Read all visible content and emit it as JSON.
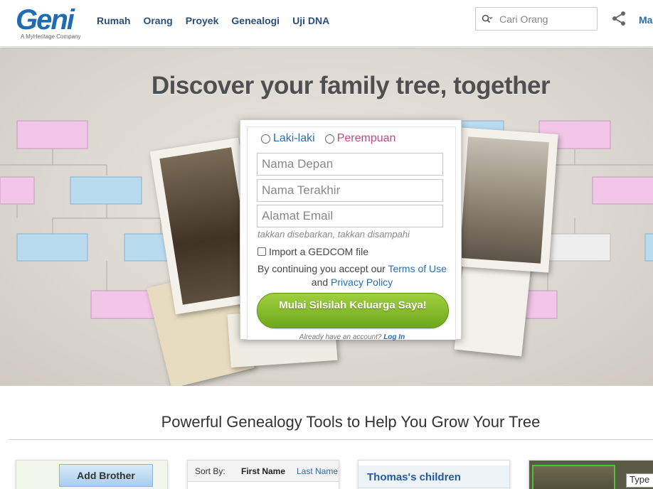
{
  "header": {
    "logo_text": "Geni",
    "logo_tagline": "A MyHeritage Company",
    "nav": [
      "Rumah",
      "Orang",
      "Proyek",
      "Genealogi",
      "Uji DNA"
    ],
    "search_placeholder": "Cari Orang",
    "more_label": "Ma"
  },
  "hero": {
    "title": "Discover your family tree, together"
  },
  "signup": {
    "gender_male": "Laki-laki",
    "gender_female": "Perempuan",
    "first_name_placeholder": "Nama Depan",
    "last_name_placeholder": "Nama Terakhir",
    "email_placeholder": "Alamat Email",
    "email_hint": "takkan disebarkan, takkan disampahi",
    "gedcom_label": "Import a GEDCOM file",
    "terms_prefix": "By continuing you accept our",
    "terms_link": "Terms of Use",
    "terms_and": "and",
    "privacy_link": "Privacy Policy",
    "cta_label": "Mulai Silsilah Keluarga Saya!",
    "already_text": "Already have an account?",
    "login_link": "Log In"
  },
  "tools": {
    "title": "Powerful Genealogy Tools to Help You Grow Your Tree",
    "card1_button": "Add Brother",
    "card2_sortby": "Sort By:",
    "card2_first": "First Name",
    "card2_last": "Last Name",
    "card3_title": "Thomas's children",
    "card4_type": "Type"
  },
  "colors": {
    "brand_blue": "#1e6cb4",
    "link_blue": "#2b6cb0",
    "female_pink": "#c0488b",
    "cta_green": "#7fb928"
  }
}
